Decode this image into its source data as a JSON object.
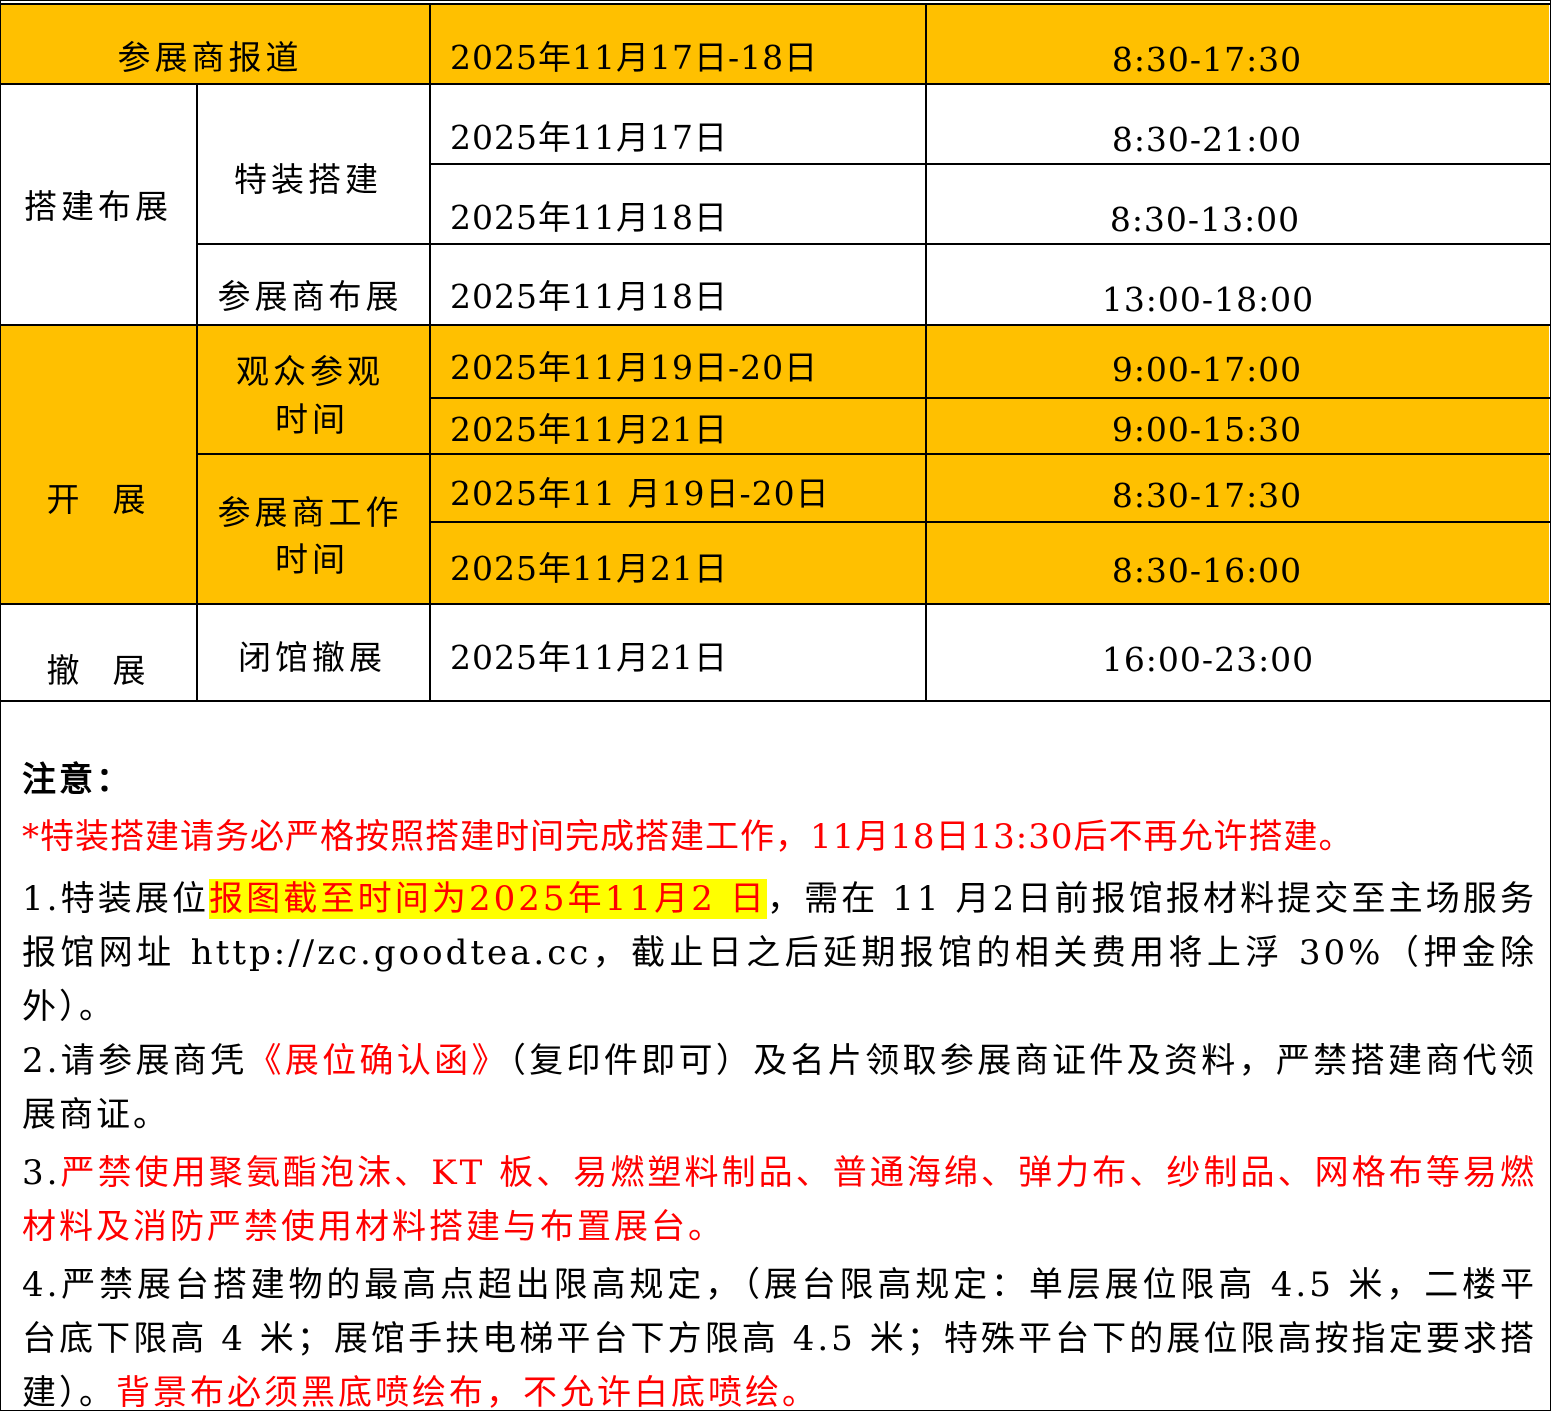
{
  "schedule": {
    "checkin": {
      "label": "参展商报道",
      "date": "2025年11月17日-18日",
      "time": "8:30-17:30"
    },
    "build": {
      "label": "搭建布展",
      "special": {
        "label": "特装搭建",
        "rows": [
          {
            "date": "2025年11月17日",
            "time": "8:30-21:00"
          },
          {
            "date": "2025年11月18日",
            "time": "8:30-13:00"
          }
        ]
      },
      "exhibitor": {
        "label": "参展商布展",
        "date": "2025年11月18日",
        "time": "13:00-18:00"
      }
    },
    "open": {
      "label": "开  展",
      "visitor": {
        "label_line1": "观众参观",
        "label_line2": "时间",
        "rows": [
          {
            "date": "2025年11月19日-20日",
            "time": "9:00-17:00"
          },
          {
            "date": "2025年11月21日",
            "time": "9:00-15:30"
          }
        ]
      },
      "exhibitor": {
        "label_line1": "参展商工作",
        "label_line2": "时间",
        "rows": [
          {
            "date": "2025年11 月19日-20日",
            "time": "8:30-17:30"
          },
          {
            "date": "2025年11月21日",
            "time": "8:30-16:00"
          }
        ]
      }
    },
    "dismantle": {
      "label": "撤  展",
      "sub": "闭馆撤展",
      "date": "2025年11月21日",
      "time": "16:00-23:00"
    }
  },
  "notes": {
    "title": "注意：",
    "warning": "*特装搭建请务必严格按照搭建时间完成搭建工作，11月18日13:30后不再允许搭建。",
    "n1_prefix": "1.特装展位",
    "n1_highlight": "报图截至时间为2025年11月2 日",
    "n1_rest": "，需在 11 月2日前报馆报材料提交至主场服务报馆网址 http://zc.goodtea.cc，截止日之后延期报馆的相关费用将上浮 30%（押金除外）。",
    "n2_prefix": "2.请参展商凭",
    "n2_red": "《展位确认函》",
    "n2_rest": "（复印件即可）及名片领取参展商证件及资料，严禁搭建商代领展商证。",
    "n3_prefix": "3.",
    "n3_red": "严禁使用聚氨酯泡沫、KT 板、易燃塑料制品、普通海绵、弹力布、纱制品、网格布等易燃材料及消防严禁使用材料搭建与布置展台。",
    "n4_text": "4.严禁展台搭建物的最高点超出限高规定，（展台限高规定：单层展位限高 4.5 米，二楼平台底下限高 4 米；展馆手扶电梯平台下方限高 4.5 米；特殊平台下的展位限高按指定要求搭建）。",
    "n4_red": "背景布必须黑底喷绘布，不允许白底喷绘。"
  },
  "colors": {
    "header_fill": "#FFC000",
    "highlight": "#FFFF00",
    "red_text": "#FF0000"
  }
}
